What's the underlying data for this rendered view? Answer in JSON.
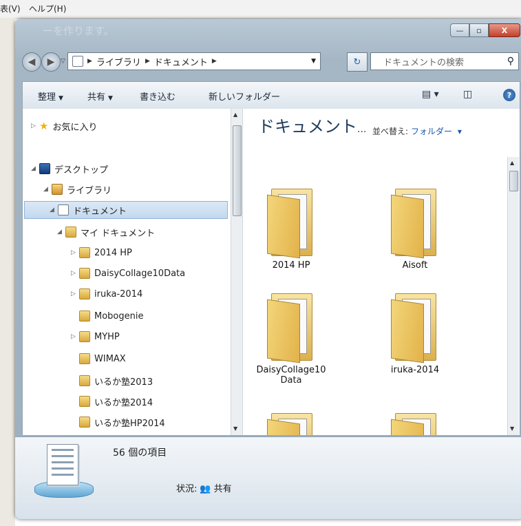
{
  "background_app": {
    "menu": [
      "表(V)",
      "ヘルプ(H)"
    ],
    "ghost_title": "ーを作ります。"
  },
  "window_controls": {
    "minimize": "—",
    "maximize": "▫",
    "close": "X"
  },
  "address_bar": {
    "segments": [
      "ライブラリ",
      "ドキュメント"
    ]
  },
  "search": {
    "placeholder": "ドキュメントの検索"
  },
  "toolbar": {
    "organize": "整理",
    "share": "共有",
    "burn": "書き込む",
    "new_folder": "新しいフォルダー"
  },
  "nav_tree": [
    {
      "label": "お気に入り"
    },
    {
      "label": "デスクトップ"
    },
    {
      "label": "ライブラリ"
    },
    {
      "label": "ドキュメント"
    },
    {
      "label": "マイ ドキュメント"
    },
    {
      "label": "2014 HP"
    },
    {
      "label": "DaisyCollage10Data"
    },
    {
      "label": "iruka-2014"
    },
    {
      "label": "Mobogenie"
    },
    {
      "label": "MYHP"
    },
    {
      "label": "WIMAX"
    },
    {
      "label": "いるか塾2013"
    },
    {
      "label": "いるか塾2014"
    },
    {
      "label": "いるか塾HP2014"
    }
  ],
  "content": {
    "title": "ドキュメント",
    "arrange_label": "並べ替え:",
    "arrange_value": "フォルダー",
    "items": [
      {
        "label": "2014 HP"
      },
      {
        "label": "Aisoft"
      },
      {
        "label": "DaisyCollage10",
        "label2": "Data"
      },
      {
        "label": "iruka-2014"
      }
    ]
  },
  "details": {
    "count": "56 個の項目",
    "status_label": "状況:",
    "status_value": "共有"
  },
  "colors": {
    "selection": "#c4d8ee",
    "chrome": "#a5b6c4",
    "link": "#1a55a8"
  }
}
